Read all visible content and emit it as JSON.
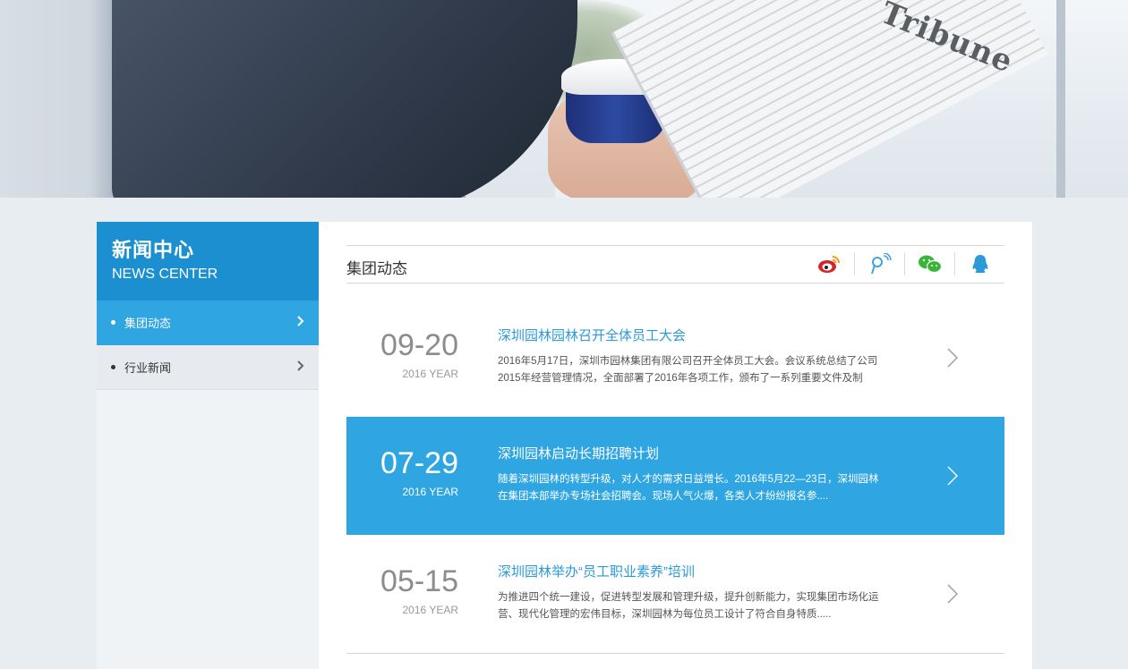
{
  "banner": {
    "newspaper_title": "Tribune"
  },
  "sidebar": {
    "title": "新闻中心",
    "subtitle": "NEWS CENTER",
    "items": [
      {
        "label": "集团动态",
        "active": true
      },
      {
        "label": "行业新闻",
        "active": false
      }
    ]
  },
  "main": {
    "title": "集团动态",
    "share_icons": [
      "weibo-icon",
      "tencent-weibo-icon",
      "wechat-icon",
      "qq-icon"
    ],
    "news": [
      {
        "date": "09-20",
        "year": "2016 YEAR",
        "title": "深圳园林园林召开全体员工大会",
        "desc": "2016年5月17日，深圳市园林集团有限公司召开全体员工大会。会议系统总结了公司2015年经营管理情况，全面部署了2016年各项工作，颁布了一系列重要文件及制",
        "active": false
      },
      {
        "date": "07-29",
        "year": "2016 YEAR",
        "title": "深圳园林启动长期招聘计划",
        "desc": "随着深圳园林的转型升级，对人才的需求日益增长。2016年5月22—23日，深圳园林在集团本部举办专场社会招聘会。现场人气火爆，各类人才纷纷报名参....",
        "active": true
      },
      {
        "date": "05-15",
        "year": "2016 YEAR",
        "title": "深圳园林举办“员工职业素养”培训",
        "desc": "为推进四个统一建设，促进转型发展和管理升级，提升创新能力，实现集团市场化运营、现代化管理的宏伟目标，深圳园林为每位员工设计了符合自身特质.....",
        "active": false
      }
    ]
  },
  "colors": {
    "accent": "#2fa5e2",
    "sidebar_header": "#1b8fd0",
    "page_bg": "#e8edf1",
    "title_link": "#2a9ad8",
    "weibo": "#d6252a",
    "wechat": "#3bb43a",
    "qq": "#2a9ad8"
  }
}
